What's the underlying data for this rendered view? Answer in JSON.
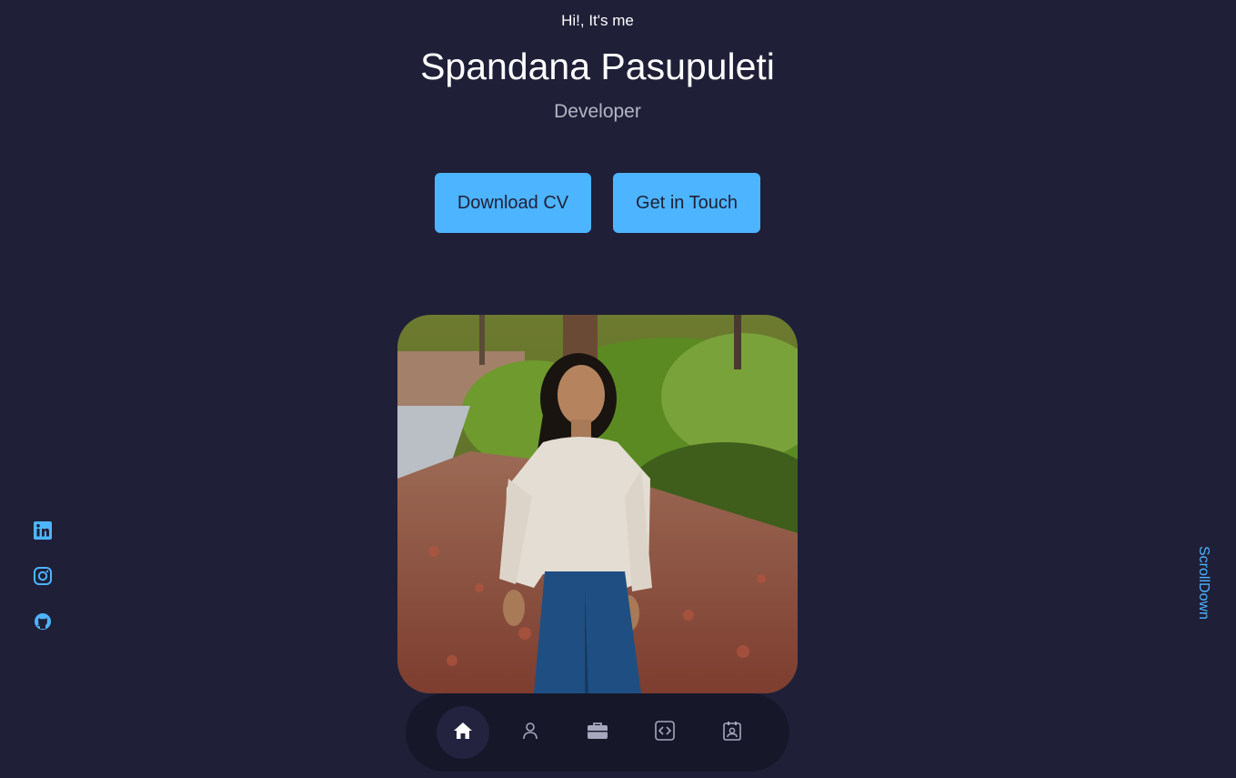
{
  "header": {
    "greeting": "Hi!, It's me",
    "name": "Spandana Pasupuleti",
    "role": "Developer"
  },
  "cta": {
    "download_label": "Download CV",
    "contact_label": "Get in Touch"
  },
  "socials": [
    {
      "icon": "linkedin-icon"
    },
    {
      "icon": "instagram-icon"
    },
    {
      "icon": "github-icon"
    }
  ],
  "scroll_label": "ScrollDown",
  "nav": {
    "items": [
      {
        "icon": "home-icon",
        "active": true
      },
      {
        "icon": "user-icon",
        "active": false
      },
      {
        "icon": "briefcase-icon",
        "active": false
      },
      {
        "icon": "code-icon",
        "active": false
      },
      {
        "icon": "contact-card-icon",
        "active": false
      }
    ]
  },
  "colors": {
    "background": "#1f1f38",
    "accent": "#4db5ff",
    "nav_background": "#17172a",
    "muted_text": "#b5b5c4"
  }
}
